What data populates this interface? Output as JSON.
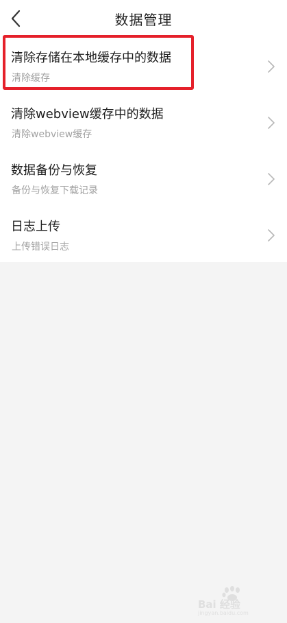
{
  "header": {
    "title": "数据管理",
    "back_icon": "chevron-left-icon"
  },
  "items": [
    {
      "title": "清除存储在本地缓存中的数据",
      "subtitle": "清除缓存"
    },
    {
      "title": "清除webview缓存中的数据",
      "subtitle": "清除webview缓存"
    },
    {
      "title": "数据备份与恢复",
      "subtitle": "备份与恢复下载记录"
    },
    {
      "title": "日志上传",
      "subtitle": "上传错误日志"
    }
  ],
  "colors": {
    "highlight": "#e5202a",
    "background": "#f4f4f4",
    "subtitle": "#a2a2a2"
  },
  "watermark": {
    "text": "Bai 经验",
    "subtext": "jingyan.baidu.com"
  }
}
